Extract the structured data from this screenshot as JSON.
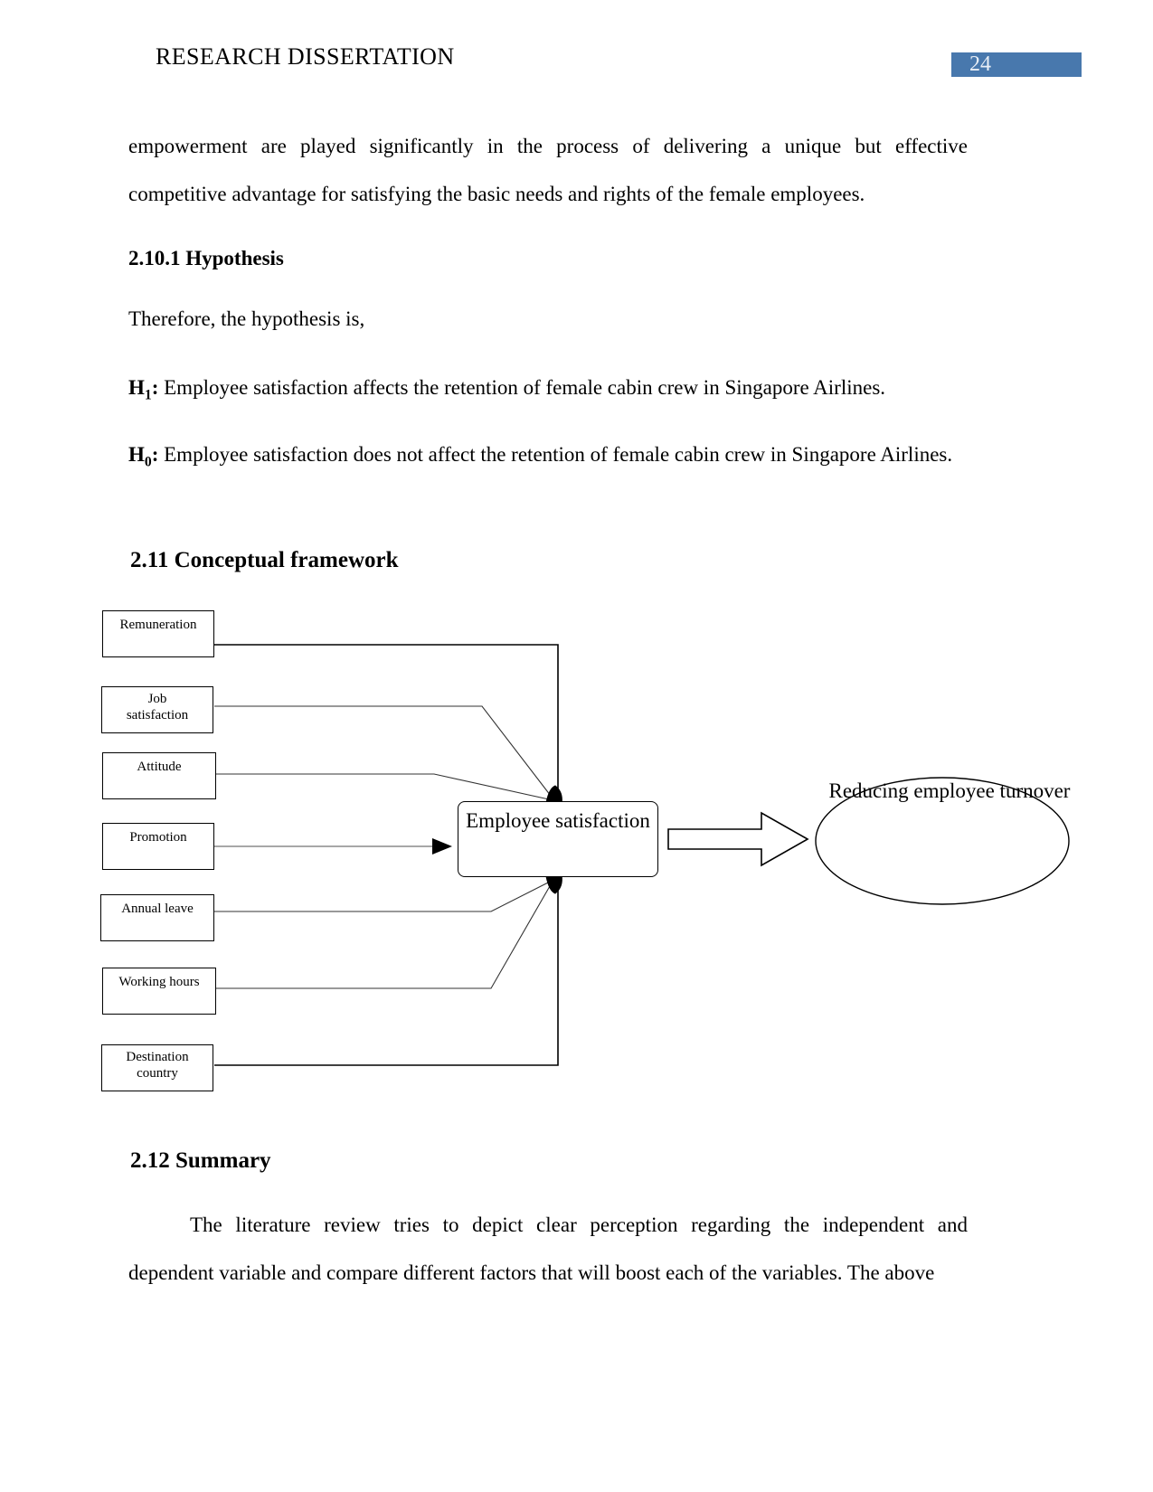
{
  "header": {
    "title": "RESEARCH DISSERTATION",
    "page_number": "24",
    "page_number_bg": "#4878ad"
  },
  "body": {
    "paragraph_1": "empowerment are played significantly in the process of delivering a unique but effective competitive advantage for satisfying the basic needs and rights of the female employees.",
    "heading_hypothesis": "2.10.1 Hypothesis",
    "therefore_line": "Therefore, the hypothesis is,",
    "hypotheses": [
      {
        "label": "H",
        "subscript": "1",
        "colon": ":",
        "text": " Employee satisfaction affects the retention of female cabin crew in Singapore Airlines."
      },
      {
        "label": "H",
        "subscript": "0",
        "colon": ":",
        "text": " Employee satisfaction does not affect the retention of female cabin crew in Singapore Airlines."
      }
    ],
    "heading_conceptual_framework": "2.11 Conceptual framework",
    "heading_summary": "2.12 Summary",
    "paragraph_summary": "The literature review tries to depict clear perception regarding the independent and dependent variable and compare different factors that will boost each of the variables. The above"
  },
  "diagram": {
    "factor_boxes": [
      {
        "label": "Remuneration"
      },
      {
        "label": "Job\nsatisfaction"
      },
      {
        "label": "Attitude"
      },
      {
        "label": "Promotion"
      },
      {
        "label": "Annual leave"
      },
      {
        "label": "Working hours"
      },
      {
        "label": "Destination\ncountry"
      }
    ],
    "central_node": "Employee satisfaction",
    "outcome_node": "Reducing employee turnover"
  }
}
